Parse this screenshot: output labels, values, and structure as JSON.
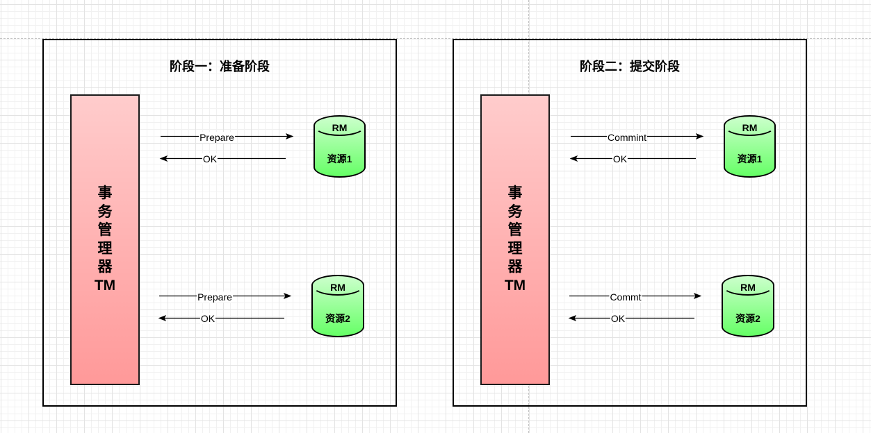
{
  "colors": {
    "manager_fill_top": "#ffcccc",
    "manager_fill_bottom": "#ff9999",
    "resource_fill_top": "#ccffcc",
    "resource_fill_bottom": "#66ff66"
  },
  "panels": [
    {
      "title": "阶段一：准备阶段",
      "manager": {
        "lines": [
          "事",
          "务",
          "管",
          "理",
          "器",
          "TM"
        ]
      },
      "rows": [
        {
          "request_label": "Prepare",
          "response_label": "OK",
          "resource": {
            "type_label": "RM",
            "name": "资源1"
          }
        },
        {
          "request_label": "Prepare",
          "response_label": "OK",
          "resource": {
            "type_label": "RM",
            "name": "资源2"
          }
        }
      ]
    },
    {
      "title": "阶段二：提交阶段",
      "manager": {
        "lines": [
          "事",
          "务",
          "管",
          "理",
          "器",
          "TM"
        ]
      },
      "rows": [
        {
          "request_label": "Commint",
          "response_label": "OK",
          "resource": {
            "type_label": "RM",
            "name": "资源1"
          }
        },
        {
          "request_label": "Commt",
          "response_label": "OK",
          "resource": {
            "type_label": "RM",
            "name": "资源2"
          }
        }
      ]
    }
  ]
}
